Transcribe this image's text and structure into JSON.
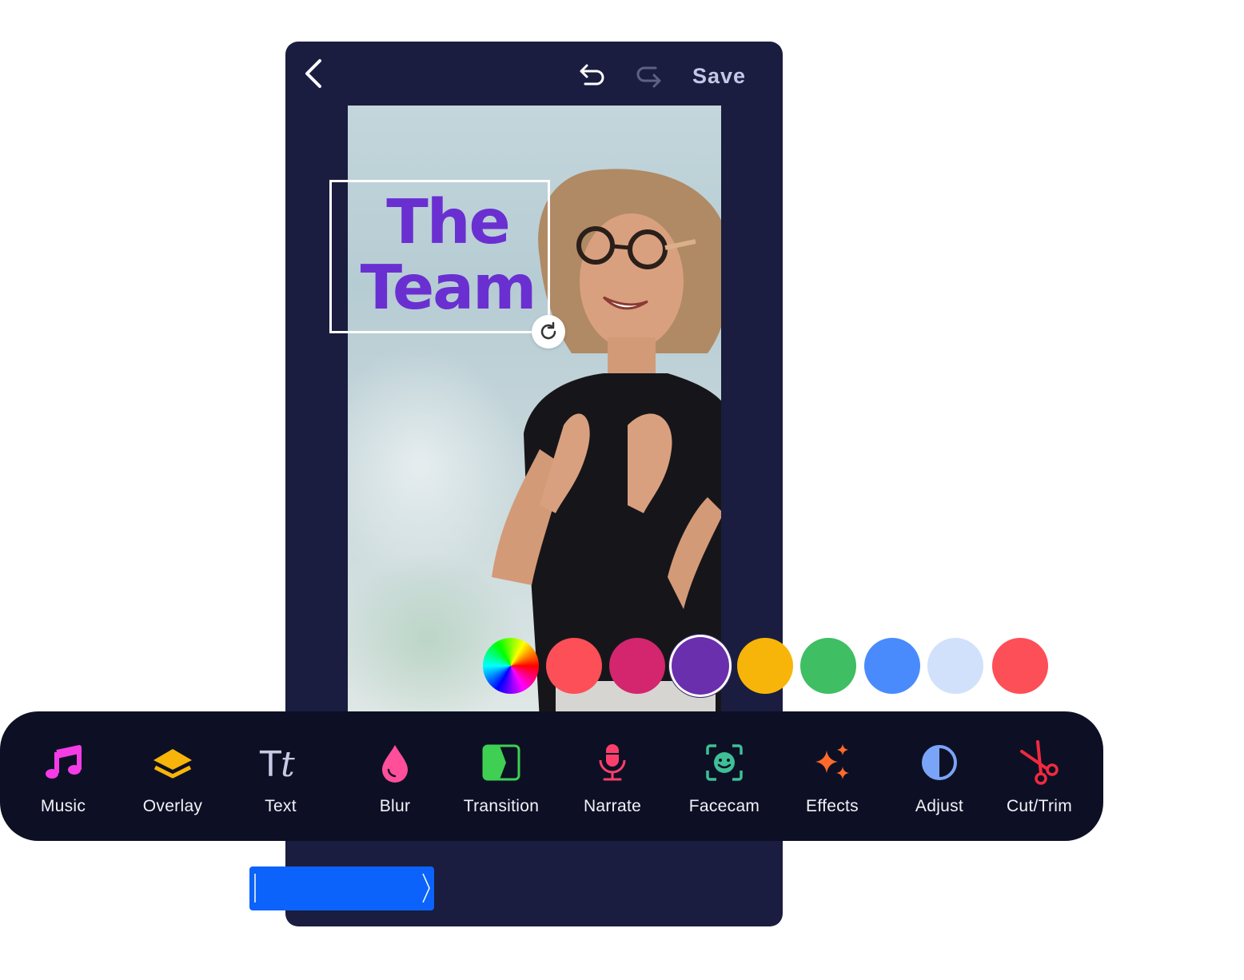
{
  "header": {
    "back_icon": "chevron-left-icon",
    "undo_icon": "undo-icon",
    "redo_icon": "redo-icon",
    "save_label": "Save"
  },
  "canvas": {
    "text_overlay": {
      "line1": "The",
      "line2": "Team",
      "color": "#6a2fd1"
    },
    "rotate_icon": "rotate-icon"
  },
  "color_picker": {
    "swatches": [
      {
        "name": "custom-color-wheel",
        "color": "conic"
      },
      {
        "name": "coral-red",
        "color": "#fd4f57"
      },
      {
        "name": "magenta",
        "color": "#d3266e"
      },
      {
        "name": "purple",
        "color": "#6a2fad",
        "selected": true
      },
      {
        "name": "amber",
        "color": "#f8b509"
      },
      {
        "name": "green",
        "color": "#3fbe63"
      },
      {
        "name": "blue",
        "color": "#498bfc"
      },
      {
        "name": "light-blue",
        "color": "#d1e1fb"
      },
      {
        "name": "red",
        "color": "#fd4f57"
      }
    ]
  },
  "toolbar": {
    "items": [
      {
        "label": "Music",
        "icon": "music-note-icon",
        "color": "#f43ce6"
      },
      {
        "label": "Overlay",
        "icon": "layers-icon",
        "color": "#f8b509"
      },
      {
        "label": "Text",
        "icon": "text-tt-icon",
        "color": "#c6cae4"
      },
      {
        "label": "Blur",
        "icon": "drop-icon",
        "color": "#ff4f9a"
      },
      {
        "label": "Transition",
        "icon": "transition-icon",
        "color": "#3ecf53"
      },
      {
        "label": "Narrate",
        "icon": "microphone-icon",
        "color": "#fb3f6c"
      },
      {
        "label": "Facecam",
        "icon": "face-scan-icon",
        "color": "#3ebf96"
      },
      {
        "label": "Effects",
        "icon": "sparkles-icon",
        "color": "#ff6a2b"
      },
      {
        "label": "Adjust",
        "icon": "contrast-icon",
        "color": "#7aa4f7"
      },
      {
        "label": "Cut/Trim",
        "icon": "scissors-icon",
        "color": "#f02a3e"
      }
    ]
  },
  "timeline": {
    "trim_handle_icon": "chevron-right-icon"
  }
}
